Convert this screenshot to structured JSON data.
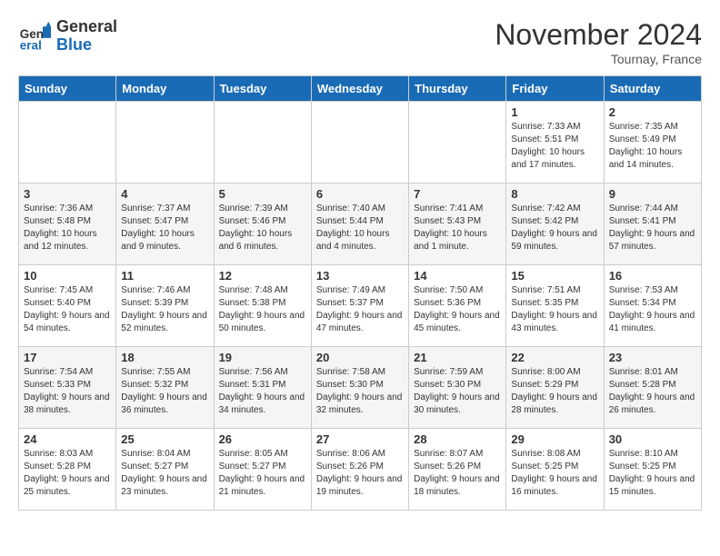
{
  "header": {
    "logo_line1": "General",
    "logo_line2": "Blue",
    "month": "November 2024",
    "location": "Tournay, France"
  },
  "days_of_week": [
    "Sunday",
    "Monday",
    "Tuesday",
    "Wednesday",
    "Thursday",
    "Friday",
    "Saturday"
  ],
  "weeks": [
    [
      {
        "day": "",
        "info": ""
      },
      {
        "day": "",
        "info": ""
      },
      {
        "day": "",
        "info": ""
      },
      {
        "day": "",
        "info": ""
      },
      {
        "day": "",
        "info": ""
      },
      {
        "day": "1",
        "info": "Sunrise: 7:33 AM\nSunset: 5:51 PM\nDaylight: 10 hours and 17 minutes."
      },
      {
        "day": "2",
        "info": "Sunrise: 7:35 AM\nSunset: 5:49 PM\nDaylight: 10 hours and 14 minutes."
      }
    ],
    [
      {
        "day": "3",
        "info": "Sunrise: 7:36 AM\nSunset: 5:48 PM\nDaylight: 10 hours and 12 minutes."
      },
      {
        "day": "4",
        "info": "Sunrise: 7:37 AM\nSunset: 5:47 PM\nDaylight: 10 hours and 9 minutes."
      },
      {
        "day": "5",
        "info": "Sunrise: 7:39 AM\nSunset: 5:46 PM\nDaylight: 10 hours and 6 minutes."
      },
      {
        "day": "6",
        "info": "Sunrise: 7:40 AM\nSunset: 5:44 PM\nDaylight: 10 hours and 4 minutes."
      },
      {
        "day": "7",
        "info": "Sunrise: 7:41 AM\nSunset: 5:43 PM\nDaylight: 10 hours and 1 minute."
      },
      {
        "day": "8",
        "info": "Sunrise: 7:42 AM\nSunset: 5:42 PM\nDaylight: 9 hours and 59 minutes."
      },
      {
        "day": "9",
        "info": "Sunrise: 7:44 AM\nSunset: 5:41 PM\nDaylight: 9 hours and 57 minutes."
      }
    ],
    [
      {
        "day": "10",
        "info": "Sunrise: 7:45 AM\nSunset: 5:40 PM\nDaylight: 9 hours and 54 minutes."
      },
      {
        "day": "11",
        "info": "Sunrise: 7:46 AM\nSunset: 5:39 PM\nDaylight: 9 hours and 52 minutes."
      },
      {
        "day": "12",
        "info": "Sunrise: 7:48 AM\nSunset: 5:38 PM\nDaylight: 9 hours and 50 minutes."
      },
      {
        "day": "13",
        "info": "Sunrise: 7:49 AM\nSunset: 5:37 PM\nDaylight: 9 hours and 47 minutes."
      },
      {
        "day": "14",
        "info": "Sunrise: 7:50 AM\nSunset: 5:36 PM\nDaylight: 9 hours and 45 minutes."
      },
      {
        "day": "15",
        "info": "Sunrise: 7:51 AM\nSunset: 5:35 PM\nDaylight: 9 hours and 43 minutes."
      },
      {
        "day": "16",
        "info": "Sunrise: 7:53 AM\nSunset: 5:34 PM\nDaylight: 9 hours and 41 minutes."
      }
    ],
    [
      {
        "day": "17",
        "info": "Sunrise: 7:54 AM\nSunset: 5:33 PM\nDaylight: 9 hours and 38 minutes."
      },
      {
        "day": "18",
        "info": "Sunrise: 7:55 AM\nSunset: 5:32 PM\nDaylight: 9 hours and 36 minutes."
      },
      {
        "day": "19",
        "info": "Sunrise: 7:56 AM\nSunset: 5:31 PM\nDaylight: 9 hours and 34 minutes."
      },
      {
        "day": "20",
        "info": "Sunrise: 7:58 AM\nSunset: 5:30 PM\nDaylight: 9 hours and 32 minutes."
      },
      {
        "day": "21",
        "info": "Sunrise: 7:59 AM\nSunset: 5:30 PM\nDaylight: 9 hours and 30 minutes."
      },
      {
        "day": "22",
        "info": "Sunrise: 8:00 AM\nSunset: 5:29 PM\nDaylight: 9 hours and 28 minutes."
      },
      {
        "day": "23",
        "info": "Sunrise: 8:01 AM\nSunset: 5:28 PM\nDaylight: 9 hours and 26 minutes."
      }
    ],
    [
      {
        "day": "24",
        "info": "Sunrise: 8:03 AM\nSunset: 5:28 PM\nDaylight: 9 hours and 25 minutes."
      },
      {
        "day": "25",
        "info": "Sunrise: 8:04 AM\nSunset: 5:27 PM\nDaylight: 9 hours and 23 minutes."
      },
      {
        "day": "26",
        "info": "Sunrise: 8:05 AM\nSunset: 5:27 PM\nDaylight: 9 hours and 21 minutes."
      },
      {
        "day": "27",
        "info": "Sunrise: 8:06 AM\nSunset: 5:26 PM\nDaylight: 9 hours and 19 minutes."
      },
      {
        "day": "28",
        "info": "Sunrise: 8:07 AM\nSunset: 5:26 PM\nDaylight: 9 hours and 18 minutes."
      },
      {
        "day": "29",
        "info": "Sunrise: 8:08 AM\nSunset: 5:25 PM\nDaylight: 9 hours and 16 minutes."
      },
      {
        "day": "30",
        "info": "Sunrise: 8:10 AM\nSunset: 5:25 PM\nDaylight: 9 hours and 15 minutes."
      }
    ]
  ]
}
